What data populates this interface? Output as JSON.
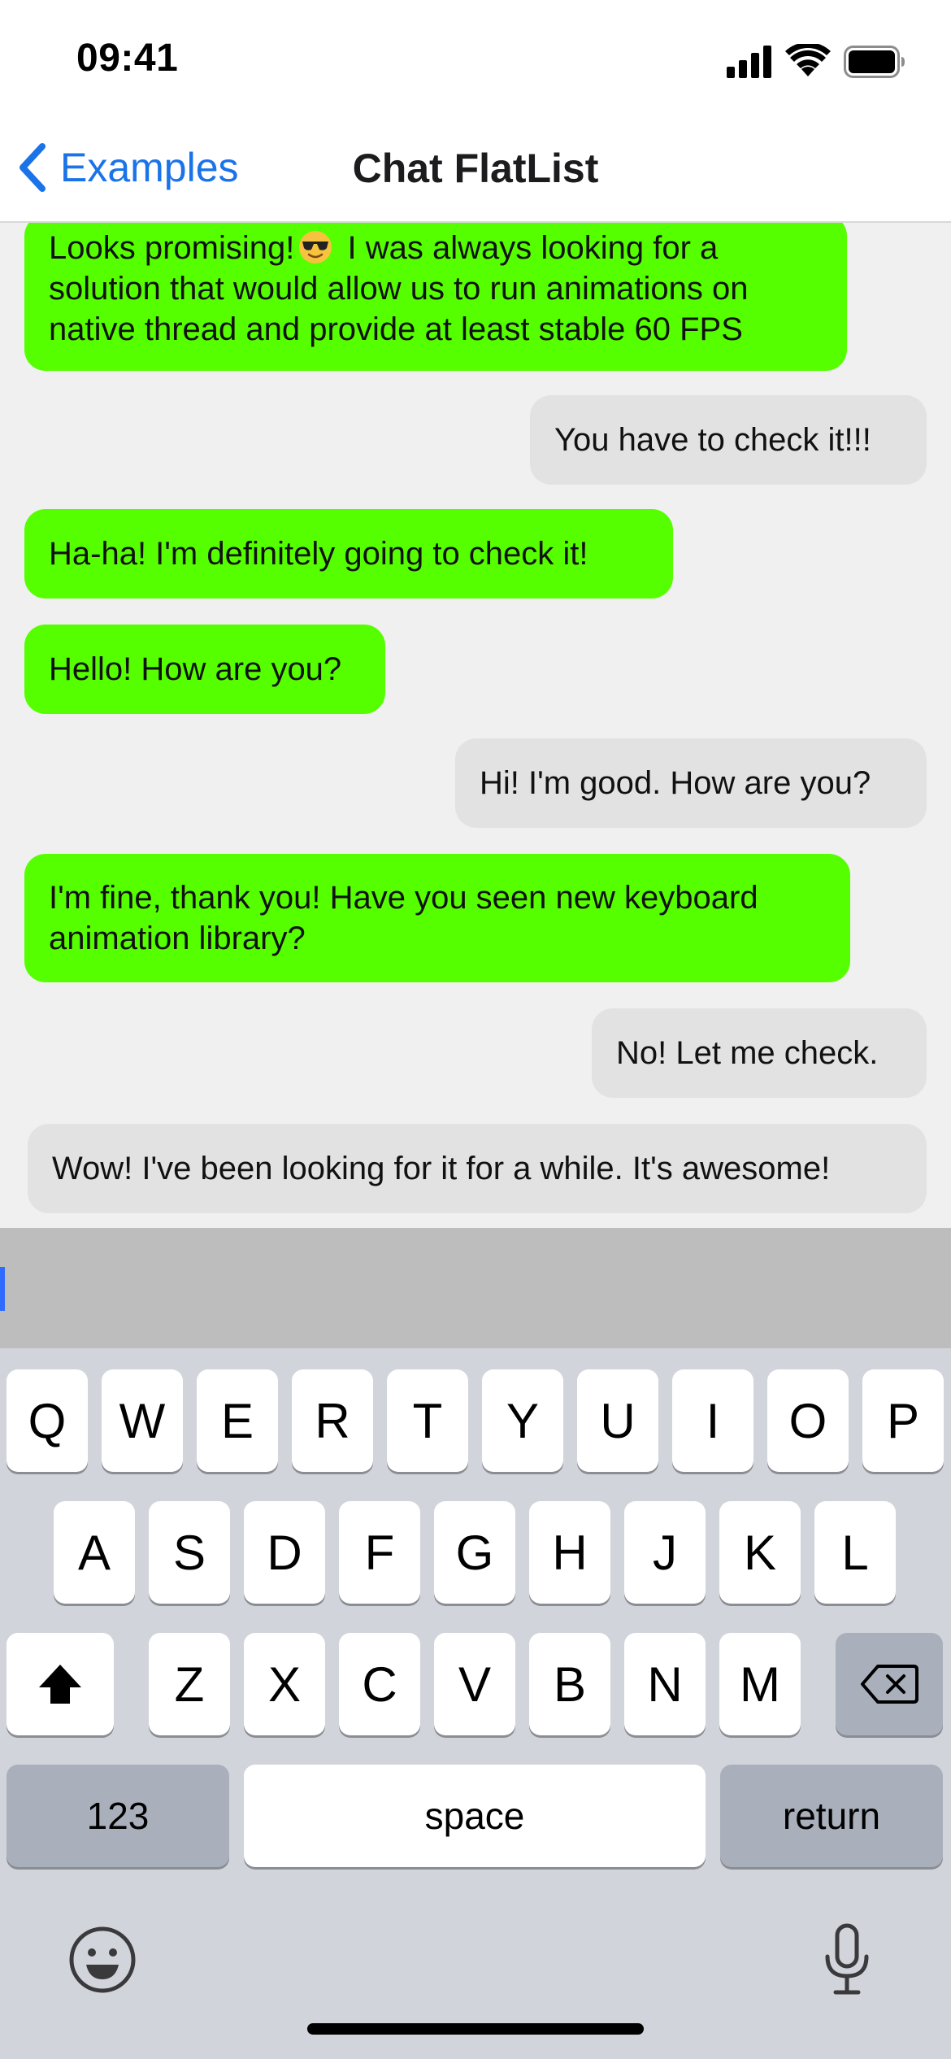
{
  "status_bar": {
    "time": "09:41"
  },
  "nav": {
    "back_label": "Examples",
    "title": "Chat FlatList"
  },
  "messages": [
    {
      "text_before": "Looks promising!",
      "text_after": " I was always looking for a solution that would allow us to run animations on native thread and provide at least stable 60 FPS",
      "emoji": "sunglasses-emoji"
    },
    {
      "text": "You have to check it!!!"
    },
    {
      "text": "Ha-ha! I'm definitely going to check it!"
    },
    {
      "text": "Hello! How are you?"
    },
    {
      "text": "Hi! I'm good. How are you?"
    },
    {
      "text": "I'm fine, thank you! Have you seen new keyboard animation library?"
    },
    {
      "text": "No! Let me check."
    },
    {
      "text": "Wow! I've been looking for it for a while. It's awesome!"
    }
  ],
  "colors": {
    "sent_bubble": "#55ff00",
    "received_bubble": "#e2e2e2",
    "accent": "#1a73e8",
    "caret": "#2f6bff"
  },
  "keyboard": {
    "row1": [
      "Q",
      "W",
      "E",
      "R",
      "T",
      "Y",
      "U",
      "I",
      "O",
      "P"
    ],
    "row2": [
      "A",
      "S",
      "D",
      "F",
      "G",
      "H",
      "J",
      "K",
      "L"
    ],
    "row3": [
      "Z",
      "X",
      "C",
      "V",
      "B",
      "N",
      "M"
    ],
    "numbers_label": "123",
    "space_label": "space",
    "return_label": "return",
    "icons": [
      "shift-icon",
      "backspace-icon",
      "emoji-icon",
      "microphone-icon"
    ]
  }
}
